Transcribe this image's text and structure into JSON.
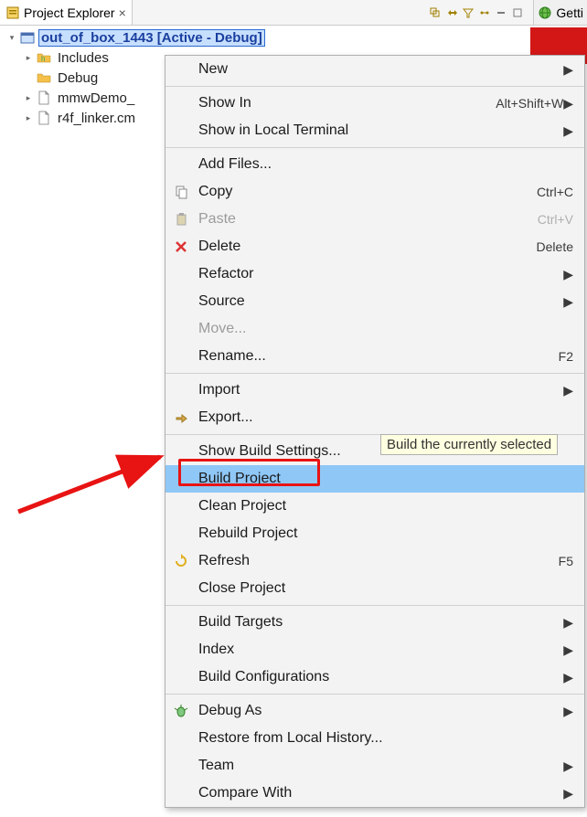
{
  "header": {
    "tab_label": "Project Explorer",
    "getting_label": "Getti"
  },
  "tree": {
    "root": {
      "label": "out_of_box_1443  [Active - Debug]",
      "children": [
        {
          "label": "Includes",
          "icon": "includes"
        },
        {
          "label": "Debug",
          "icon": "folder"
        },
        {
          "label": "mmwDemo_",
          "icon": "file"
        },
        {
          "label": "r4f_linker.cm",
          "icon": "file"
        }
      ]
    }
  },
  "menu": {
    "groups": [
      [
        {
          "label": "New",
          "submenu": true
        }
      ],
      [
        {
          "label": "Show In",
          "shortcut": "Alt+Shift+W",
          "submenu": true
        },
        {
          "label": "Show in Local Terminal",
          "submenu": true
        }
      ],
      [
        {
          "label": "Add Files..."
        },
        {
          "label": "Copy",
          "shortcut": "Ctrl+C",
          "icon": "copy"
        },
        {
          "label": "Paste",
          "shortcut": "Ctrl+V",
          "icon": "paste",
          "disabled": true
        },
        {
          "label": "Delete",
          "shortcut": "Delete",
          "icon": "delete"
        },
        {
          "label": "Refactor",
          "submenu": true
        },
        {
          "label": "Source",
          "submenu": true
        },
        {
          "label": "Move...",
          "disabled": true
        },
        {
          "label": "Rename...",
          "shortcut": "F2"
        }
      ],
      [
        {
          "label": "Import",
          "submenu": true
        },
        {
          "label": "Export...",
          "icon": "export"
        }
      ],
      [
        {
          "label": "Show Build Settings..."
        },
        {
          "label": "Build Project",
          "highlighted": true
        },
        {
          "label": "Clean Project"
        },
        {
          "label": "Rebuild Project"
        },
        {
          "label": "Refresh",
          "shortcut": "F5",
          "icon": "refresh"
        },
        {
          "label": "Close Project"
        }
      ],
      [
        {
          "label": "Build Targets",
          "submenu": true
        },
        {
          "label": "Index",
          "submenu": true
        },
        {
          "label": "Build Configurations",
          "submenu": true
        }
      ],
      [
        {
          "label": "Debug As",
          "submenu": true,
          "icon": "debug"
        },
        {
          "label": "Restore from Local History..."
        },
        {
          "label": "Team",
          "submenu": true
        },
        {
          "label": "Compare With",
          "submenu": true
        }
      ]
    ]
  },
  "tooltip": "Build the currently selected",
  "colors": {
    "selection_bg": "#c7dfff",
    "menu_highlight": "#8fc7f7",
    "annotation_red": "#e81313"
  }
}
